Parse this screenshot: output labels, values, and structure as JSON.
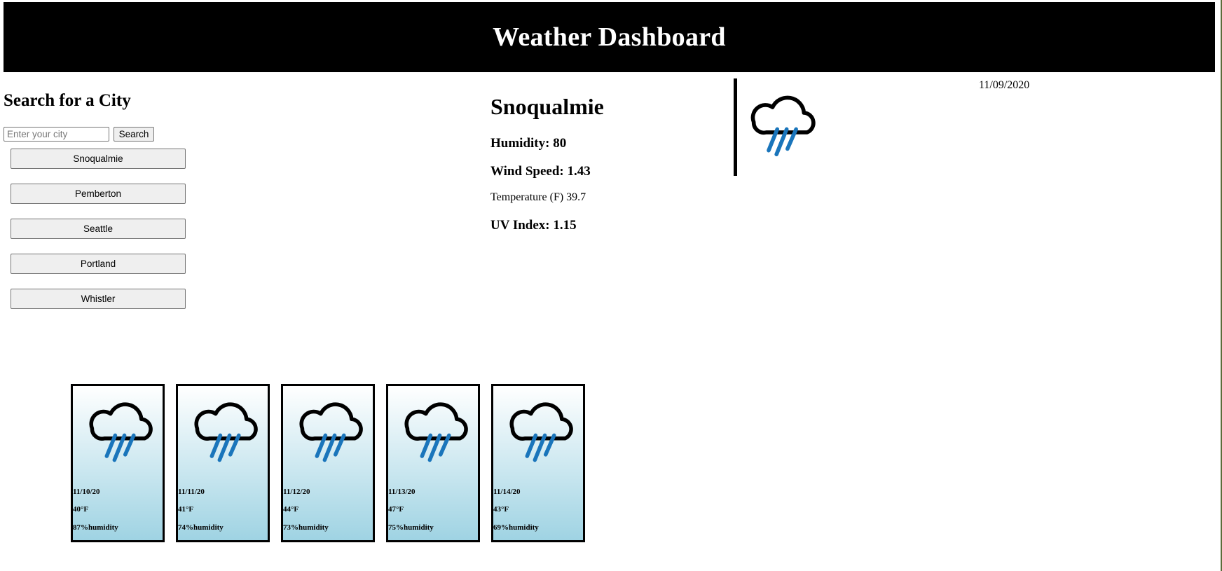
{
  "header": {
    "title": "Weather Dashboard"
  },
  "search": {
    "title": "Search for a City",
    "placeholder": "Enter your city",
    "button_label": "Search"
  },
  "history": [
    {
      "label": "Snoqualmie"
    },
    {
      "label": "Pemberton"
    },
    {
      "label": "Seattle"
    },
    {
      "label": "Portland"
    },
    {
      "label": "Whistler"
    }
  ],
  "current": {
    "city": "Snoqualmie",
    "humidity": "Humidity: 80",
    "wind": "Wind Speed: 1.43",
    "temperature": "Temperature (F) 39.7",
    "uv": "UV Index: 1.15",
    "date": "11/09/2020",
    "icon": "rain-cloud-icon"
  },
  "forecast": [
    {
      "date": "11/10/20",
      "temp": "40°F",
      "humidity": "87%humidity",
      "icon": "rain-cloud-icon"
    },
    {
      "date": "11/11/20",
      "temp": "41°F",
      "humidity": "74%humidity",
      "icon": "rain-cloud-icon"
    },
    {
      "date": "11/12/20",
      "temp": "44°F",
      "humidity": "73%humidity",
      "icon": "rain-cloud-icon"
    },
    {
      "date": "11/13/20",
      "temp": "47°F",
      "humidity": "75%humidity",
      "icon": "rain-cloud-icon"
    },
    {
      "date": "11/14/20",
      "temp": "43°F",
      "humidity": "69%humidity",
      "icon": "rain-cloud-icon"
    }
  ],
  "colors": {
    "header_bg": "#000000",
    "rain": "#1a75bb",
    "card_gradient_bottom": "#9fd3e3"
  }
}
